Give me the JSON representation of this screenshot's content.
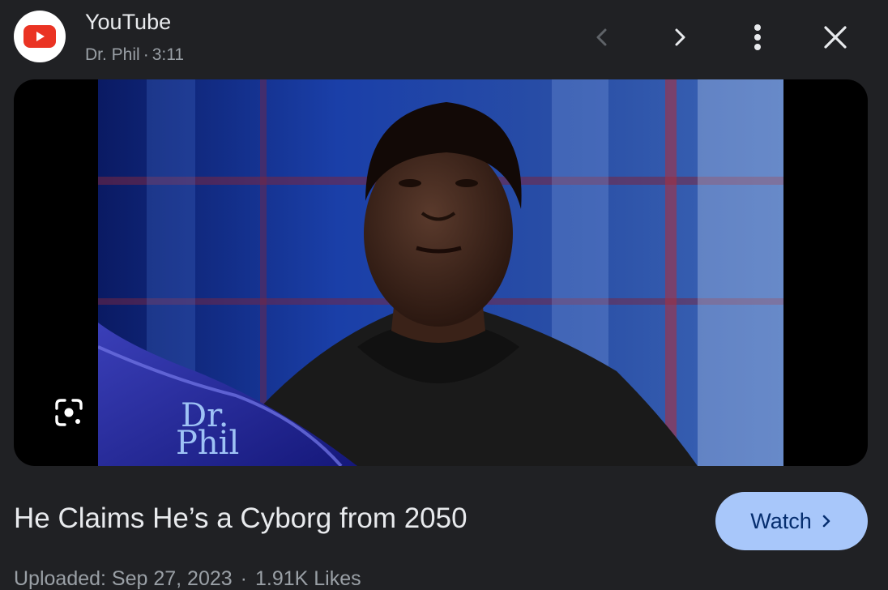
{
  "header": {
    "source_name": "YouTube",
    "channel": "Dr. Phil",
    "separator": "·",
    "duration": "3:11",
    "icons": {
      "logo": "youtube-logo-icon",
      "prev": "chevron-left-icon",
      "next": "chevron-right-icon",
      "more": "more-vert-icon",
      "close": "close-icon"
    }
  },
  "preview": {
    "watermark_line1": "Dr.",
    "watermark_line2": "Phil",
    "lens_icon": "google-lens-icon"
  },
  "footer": {
    "title": "He Claims He’s a Cyborg from 2050",
    "watch_label": "Watch",
    "uploaded": "Uploaded: Sep 27, 2023",
    "dot": "·",
    "likes": "1.91K Likes"
  },
  "colors": {
    "background": "#202124",
    "accent": "#a8c7fa",
    "accent_text": "#062e6f",
    "youtube_red": "#ea3323"
  }
}
